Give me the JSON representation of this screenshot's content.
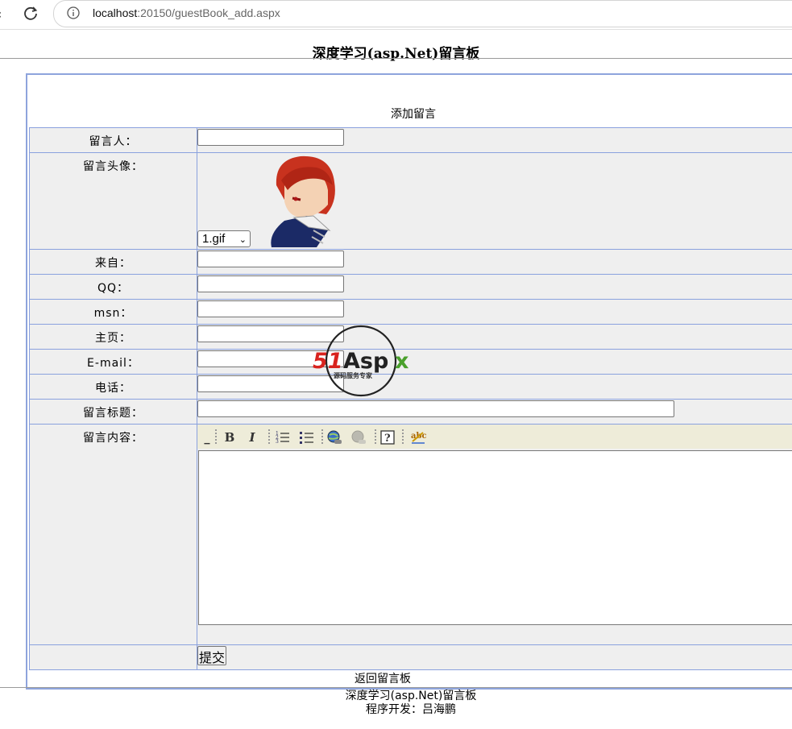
{
  "browser": {
    "url_host": "localhost",
    "url_rest": ":20150/guestBook_add.aspx"
  },
  "page": {
    "title": "深度学习(asp.Net)留言板",
    "subtitle": "添加留言"
  },
  "form": {
    "labels": {
      "name": "留言人：",
      "avatar": "留言头像：",
      "from": "来自：",
      "qq": "QQ：",
      "msn": "msn：",
      "homepage": "主页：",
      "email": "E-mail：",
      "phone": "电话：",
      "subject": "留言标题：",
      "content": "留言内容："
    },
    "avatar_selected": "1.gif",
    "submit_label": "提交"
  },
  "back_link": "返回留言板",
  "footer": {
    "line1": "深度学习(asp.Net)留言板",
    "line2": "程序开发：吕海鹏"
  },
  "watermark": {
    "brand": "51Aspx",
    "tagline": "源码服务专家"
  },
  "colors": {
    "border": "#8aa1de",
    "cell_bg": "#efefef",
    "toolbar_bg": "#eeecd9"
  }
}
